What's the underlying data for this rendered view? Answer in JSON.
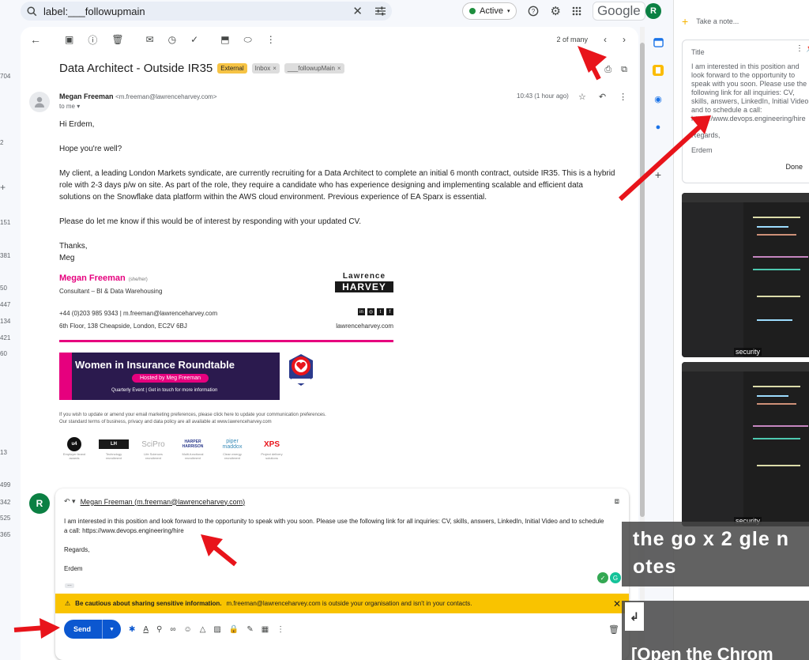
{
  "gutter_counts": [
    "704",
    "2",
    "+",
    "151",
    "381",
    "50",
    "447",
    "134",
    "421",
    "60",
    "13",
    "499",
    "342",
    "525",
    "365"
  ],
  "search": {
    "query": "label:___followupmain"
  },
  "topbar": {
    "status": "Active",
    "logo": "Google",
    "avatar_letter": "R"
  },
  "toolbar": {
    "pager": "2 of many"
  },
  "email": {
    "subject": "Data Architect - Outside IR35",
    "labels": [
      "External",
      "Inbox",
      "___followupMain"
    ],
    "sender_name": "Megan Freeman",
    "sender_email": "<m.freeman@lawrenceharvey.com>",
    "to": "to me",
    "time": "10:43 (1 hour ago)",
    "greeting": "Hi Erdem,",
    "p1": "Hope you're well?",
    "p2": "My client, a leading London Markets syndicate, are currently recruiting for a Data Architect to complete an initial 6 month contract, outside IR35. This is a hybrid role with 2-3 days p/w on site. As part of the role, they require a candidate who has experience designing and implementing scalable and efficient data solutions on the Snowflake data platform within the AWS cloud environment. Previous experience of EA Sparx is essential.",
    "p3": "Please do let me know if this would be of interest by responding with your updated CV.",
    "signoff": "Thanks,",
    "signname": "Meg"
  },
  "signature": {
    "name": "Megan Freeman",
    "pronouns": "(she/her)",
    "role": "Consultant – BI & Data Warehousing",
    "contact": "+44 (0)203 985 9343   |   m.freeman@lawrenceharvey.com",
    "address": "6th Floor, 138 Cheapside, London, EC2V 6BJ",
    "site": "lawrenceharvey.com",
    "logo_top": "Lawrence",
    "logo_bottom": "HARVEY",
    "banner_title": "Women in Insurance Roundtable",
    "banner_host": "Hosted by Meg Freeman",
    "banner_sub": "Quarterly Event  |  Get in touch for more information",
    "fine1": "If you wish to update or amend your email marketing preferences, please click here to update your communication preferences.",
    "fine2": "Our standard terms of business, privacy and data policy are all available at www.lawrenceharvey.com",
    "partners": [
      {
        "logo": "u4",
        "cap": "Employer brand awards"
      },
      {
        "logo": "LH",
        "cap": "Technology recruitment"
      },
      {
        "logo": "SciPro",
        "cap": "Life Sciences recruitment"
      },
      {
        "logo": "HARPER HARRISON",
        "cap": "Multi-functional recruitment"
      },
      {
        "logo": "piper maddox",
        "cap": "Clean energy recruitment"
      },
      {
        "logo": "XPS",
        "cap": "Project delivery solutions"
      }
    ]
  },
  "reply": {
    "to": "Megan Freeman (m.freeman@lawrenceharvey.com)",
    "avatar_letter": "R",
    "text1": "I am interested in this position and look forward to the opportunity to speak with you soon. Please use the following link for all inquiries: CV, skills, answers, LinkedIn, Initial Video and to schedule a call: https://www.devops.engineering/hire",
    "text2": "Regards,",
    "text3": "Erdem",
    "warning_bold": "Be cautious about sharing sensitive information.",
    "warning_rest": "m.freeman@lawrenceharvey.com is outside your organisation and isn't in your contacts.",
    "send_label": "Send"
  },
  "keep": {
    "take_note": "Take a note...",
    "note_title": "Title",
    "note_body": "I am interested in this position and look forward to the opportunity to speak with you soon. Please use the following link for all inquiries: CV, skills, answers, LinkedIn, Initial Video and to schedule a call: https://www.devops.engineering/hire",
    "note_regards": "Regards,",
    "note_name": "Erdem",
    "done_label": "Done",
    "thumb_caption": "security"
  },
  "overlay": {
    "line1": "the go x 2 gle n",
    "line2": "otes",
    "line3": "[Open the Chrom"
  },
  "colors": {
    "accent": "#0b57d0",
    "warning": "#f9c300",
    "brand_pink": "#e6007e",
    "arrow": "#e8141b"
  }
}
